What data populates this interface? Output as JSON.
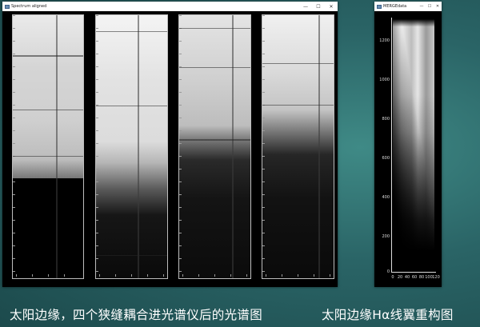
{
  "window_left": {
    "title": "Spectrum aligned",
    "buttons": {
      "minimize": "—",
      "maximize": "☐",
      "close": "✕"
    }
  },
  "window_right": {
    "title": "MERGEdata",
    "buttons": {
      "minimize": "—",
      "maximize": "☐",
      "close": "✕"
    },
    "y_ticks": [
      "1200",
      "1000",
      "800",
      "600",
      "400",
      "200",
      "0"
    ],
    "x_ticks": [
      "0",
      "20",
      "40",
      "60",
      "80",
      "100",
      "120"
    ]
  },
  "captions": {
    "left": "太阳边缘，四个狭缝耦合进光谱仪后的光谱图",
    "right": "太阳边缘Hα线翼重构图"
  }
}
